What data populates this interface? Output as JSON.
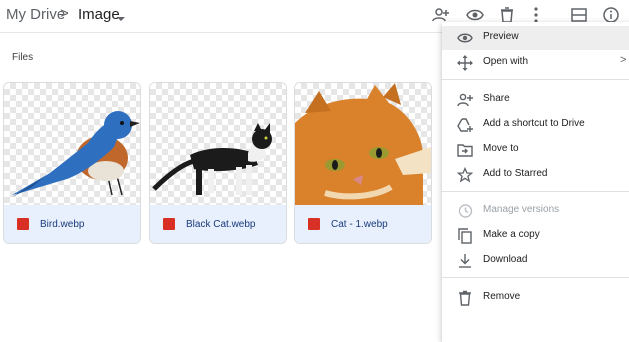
{
  "breadcrumb": {
    "root": "My Drive",
    "separator": ">",
    "current": "Image"
  },
  "section": {
    "files_label": "Files"
  },
  "files": [
    {
      "name": "Bird.webp",
      "icon": "image-file-icon"
    },
    {
      "name": "Black Cat.webp",
      "icon": "image-file-icon"
    },
    {
      "name": "Cat - 1.webp",
      "icon": "image-file-icon"
    }
  ],
  "context_menu": {
    "items": [
      {
        "label": "Preview",
        "icon": "eye-icon"
      },
      {
        "label": "Open with",
        "icon": "move-arrows-icon",
        "submenu_arrow": ">"
      },
      {
        "label": "Share",
        "icon": "add-person-icon"
      },
      {
        "label": "Add a shortcut to Drive",
        "icon": "add-shortcut-icon"
      },
      {
        "label": "Move to",
        "icon": "move-to-folder-icon"
      },
      {
        "label": "Add to Starred",
        "icon": "star-icon"
      },
      {
        "label": "Manage versions",
        "icon": "history-icon",
        "disabled": true
      },
      {
        "label": "Make a copy",
        "icon": "copy-icon"
      },
      {
        "label": "Download",
        "icon": "download-icon"
      },
      {
        "label": "Remove",
        "icon": "trash-icon"
      }
    ]
  },
  "colors": {
    "accent": "#1a73e8",
    "file_icon": "#d93025",
    "selected_card": "#e8f0fe"
  }
}
